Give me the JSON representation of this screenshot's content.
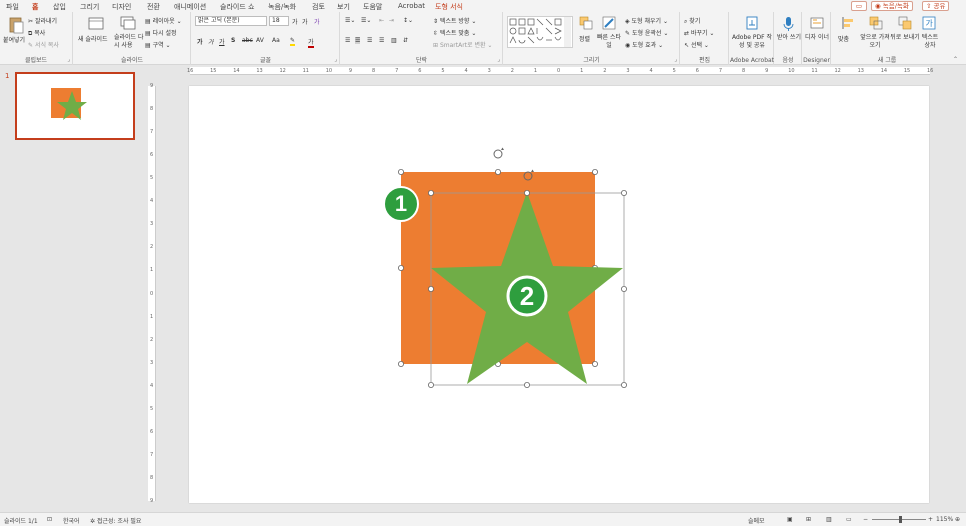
{
  "menu": {
    "tabs": [
      "파일",
      "홈",
      "삽입",
      "그리기",
      "디자인",
      "전환",
      "애니메이션",
      "슬라이드 쇼",
      "녹음/녹화",
      "검토",
      "보기",
      "도움말",
      "Acrobat",
      "도형 서식"
    ],
    "comment_icon": "comment-icon",
    "record_label": "◉ 녹음/녹화",
    "share_label": "⇧ 공유"
  },
  "ribbon": {
    "clipboard": {
      "paste": "붙여넣기",
      "cut": "잘라내기",
      "copy": "복사",
      "format_painter": "서식 복사",
      "label": "클립보드"
    },
    "slides": {
      "new_slide": "새 슬라이드",
      "reuse": "슬라이드 다시 사용",
      "layout": "레이아웃",
      "reset": "다시 설정",
      "section": "구역",
      "label": "슬라이드"
    },
    "font": {
      "name": "맑은 고딕 (본문)",
      "size": "18",
      "grow": "가",
      "shrink": "가",
      "clear": "가",
      "bold": "가",
      "italic": "가",
      "underline": "가",
      "shadow": "S",
      "strike": "abc",
      "spacing": "AV",
      "case": "Aa",
      "highlight": "✎",
      "color": "가",
      "label": "글꼴"
    },
    "paragraph": {
      "text_direction": "텍스트 방향",
      "align_text": "텍스트 맞춤",
      "smartart": "SmartArt로 변환",
      "label": "단락"
    },
    "drawing": {
      "arrange": "정렬",
      "quick_styles": "빠른 스타일",
      "fill": "도형 채우기",
      "outline": "도형 윤곽선",
      "effects": "도형 효과",
      "label": "그리기"
    },
    "editing": {
      "find": "찾기",
      "replace": "바꾸기",
      "select": "선택",
      "label": "편집"
    },
    "acrobat": {
      "create_pdf": "Adobe PDF 작성 및 공유",
      "label": "Adobe Acrobat"
    },
    "voice": {
      "dictate": "받아 쓰기",
      "label": "음성"
    },
    "designer": {
      "designer": "디자 이너",
      "label": "Designer"
    },
    "newgroup": {
      "align": "맞춤",
      "bring_forward": "앞으로 가져오기",
      "send_backward": "뒤로 보내기",
      "textbox": "텍스트 상자",
      "label": "새 그룹"
    }
  },
  "thumbnail": {
    "number": "1"
  },
  "ruler": {
    "h_ticks": [
      "16",
      "15",
      "14",
      "13",
      "12",
      "11",
      "10",
      "9",
      "8",
      "7",
      "6",
      "5",
      "4",
      "3",
      "2",
      "1",
      "0",
      "1",
      "2",
      "3",
      "4",
      "5",
      "6",
      "7",
      "8",
      "9",
      "10",
      "11",
      "12",
      "13",
      "14",
      "15",
      "16"
    ],
    "v_ticks": [
      "9",
      "8",
      "7",
      "6",
      "5",
      "4",
      "3",
      "2",
      "1",
      "0",
      "1",
      "2",
      "3",
      "4",
      "5",
      "6",
      "7",
      "8",
      "9"
    ]
  },
  "slide": {
    "square_color": "#ed7d31",
    "star_color": "#70ad47",
    "badge_color": "#2e9e3e",
    "label_square": "1",
    "label_star": "2"
  },
  "status": {
    "slide_info": "슬라이드 1/1",
    "language": "한국어",
    "accessibility": "접근성: 조사 필요",
    "notes": "슬메모",
    "zoom": "115%"
  }
}
